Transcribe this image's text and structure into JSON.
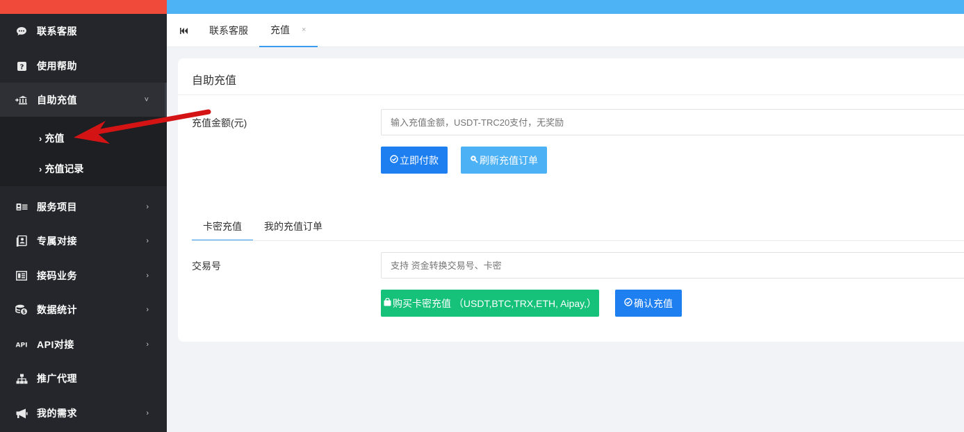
{
  "colors": {
    "sidebar_bg": "#24262b",
    "sidebar_accent": "#f04a3a",
    "topbar": "#4eb3f4",
    "primary": "#1e7ff1",
    "light_blue": "#4db1f5",
    "green": "#16c17a",
    "annotation_arrow": "#d41414"
  },
  "sidebar": {
    "items": [
      {
        "label": "联系客服",
        "icon": "chat-bubble-icon"
      },
      {
        "label": "使用帮助",
        "icon": "question-icon"
      },
      {
        "label": "自助充值",
        "icon": "bank-icon",
        "expanded": true
      },
      {
        "label": "服务项目",
        "icon": "id-card-icon"
      },
      {
        "label": "专属对接",
        "icon": "contact-card-icon"
      },
      {
        "label": "接码业务",
        "icon": "code-icon"
      },
      {
        "label": "数据统计",
        "icon": "coins-icon"
      },
      {
        "label": "API对接",
        "icon": "api-icon"
      },
      {
        "label": "推广代理",
        "icon": "sitemap-icon"
      },
      {
        "label": "我的需求",
        "icon": "megaphone-icon"
      }
    ],
    "subitems": [
      {
        "label": "充值"
      },
      {
        "label": "充值记录"
      }
    ]
  },
  "tabs": {
    "items": [
      {
        "label": "联系客服"
      },
      {
        "label": "充值",
        "active": true,
        "close": "×"
      }
    ]
  },
  "card": {
    "title": "自助充值",
    "amount_label": "充值金额(元)",
    "amount_placeholder": "输入充值金额，USDT-TRC20支付，无奖励",
    "pay_button": "立即付款",
    "refresh_button": "刷新充值订单",
    "subtabs": [
      {
        "label": "卡密充值",
        "active": true
      },
      {
        "label": "我的充值订单"
      }
    ],
    "txn_label": "交易号",
    "txn_placeholder": "支持 资金转换交易号、卡密",
    "buy_card_button": "购买卡密充值 （USDT,BTC,TRX,ETH, Aipay,）",
    "confirm_button": "确认充值"
  }
}
